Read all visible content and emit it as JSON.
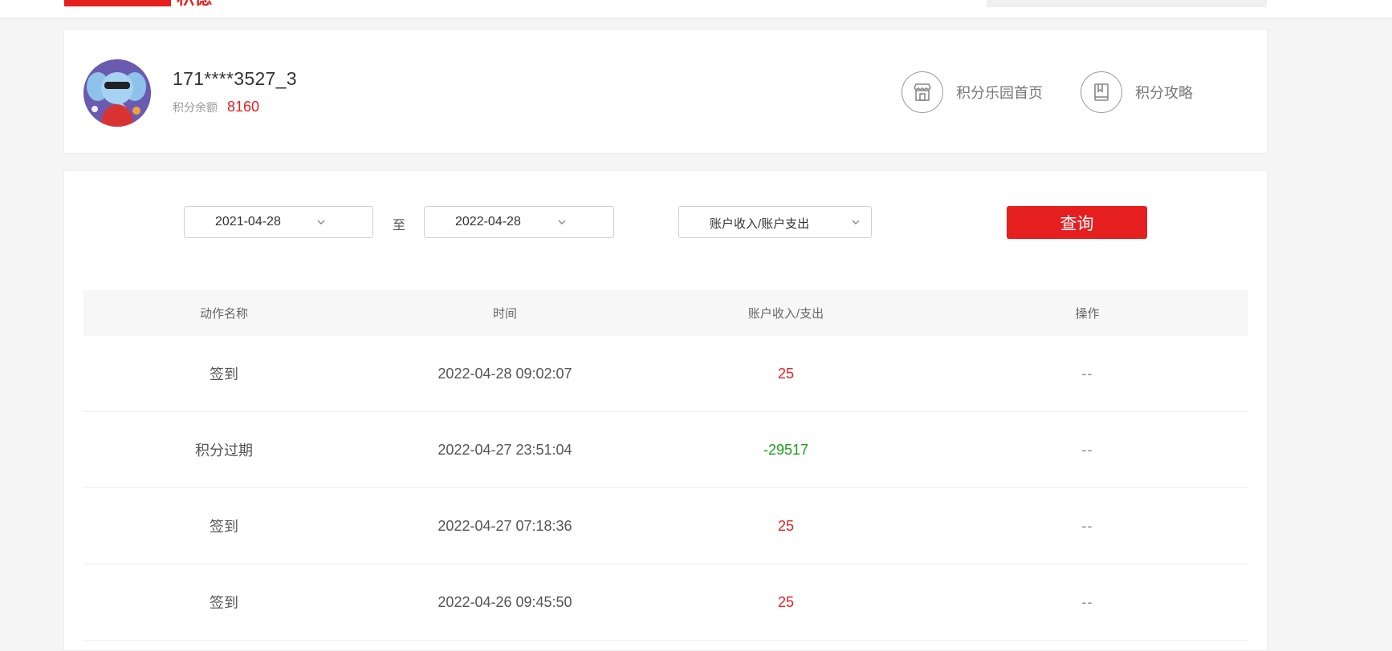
{
  "header": {
    "logo_text": "积德"
  },
  "profile": {
    "username": "171****3527_3",
    "balance_label": "积分余额",
    "balance_value": "8160",
    "avatar_icon": "elephant-mascot-avatar"
  },
  "quick_links": [
    {
      "label": "积分乐园首页",
      "icon": "store-icon"
    },
    {
      "label": "积分攻略",
      "icon": "book-icon"
    }
  ],
  "filters": {
    "start_date": "2021-04-28",
    "range_separator": "至",
    "end_date": "2022-04-28",
    "type_select": "账户收入/账户支出",
    "query_button": "查询"
  },
  "table": {
    "headers": [
      "动作名称",
      "时间",
      "账户收入/支出",
      "操作"
    ],
    "rows": [
      {
        "action": "签到",
        "time": "2022-04-28 09:02:07",
        "amount": "25",
        "op": "--"
      },
      {
        "action": "积分过期",
        "time": "2022-04-27 23:51:04",
        "amount": "-29517",
        "op": "--"
      },
      {
        "action": "签到",
        "time": "2022-04-27 07:18:36",
        "amount": "25",
        "op": "--"
      },
      {
        "action": "签到",
        "time": "2022-04-26 09:45:50",
        "amount": "25",
        "op": "--"
      }
    ]
  },
  "colors": {
    "accent_red": "#e51f20",
    "negative_green": "#1aa01a"
  }
}
